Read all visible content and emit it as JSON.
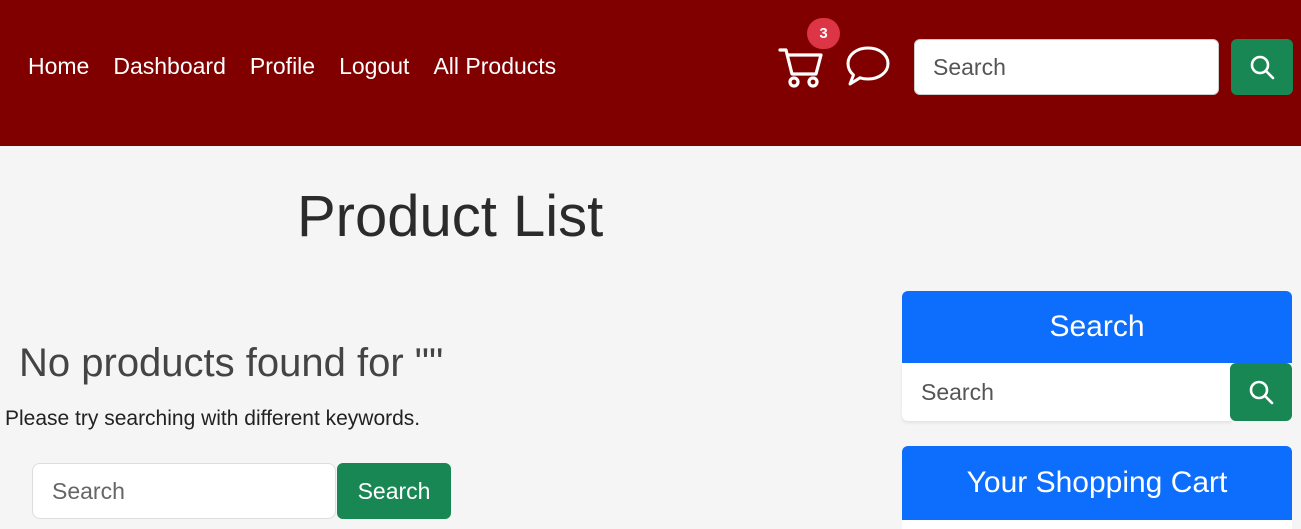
{
  "nav": {
    "links": [
      "Home",
      "Dashboard",
      "Profile",
      "Logout",
      "All Products"
    ],
    "cart_count": "3",
    "search_placeholder": "Search",
    "icons": [
      "cart-icon",
      "chat-icon",
      "search-icon"
    ]
  },
  "main": {
    "title": "Product List",
    "empty_heading": "No products found for \"\"",
    "empty_text": "Please try searching with different keywords.",
    "search_placeholder": "Search",
    "search_button": "Search"
  },
  "sidebar": {
    "search_title": "Search",
    "search_placeholder": "Search",
    "cart_title": "Your Shopping Cart"
  },
  "colors": {
    "navbar": "#800000",
    "primary": "#0d6efd",
    "success": "#198754",
    "badge": "#dc3545"
  }
}
